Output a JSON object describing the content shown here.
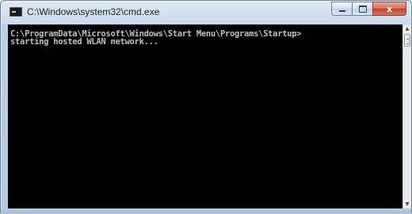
{
  "window": {
    "title": "C:\\Windows\\system32\\cmd.exe",
    "app_icon": "cmd-icon",
    "controls": {
      "minimize_icon": "minimize-icon",
      "maximize_icon": "maximize-icon",
      "close_glyph": "x"
    }
  },
  "console": {
    "lines": [
      "C:\\ProgramData\\Microsoft\\Windows\\Start Menu\\Programs\\Startup>",
      "starting hosted WLAN network..."
    ],
    "background_color": "#000000",
    "text_color": "#c0c0c0"
  },
  "scrollbar": {
    "up_arrow": "▲",
    "down_arrow": "▼"
  }
}
